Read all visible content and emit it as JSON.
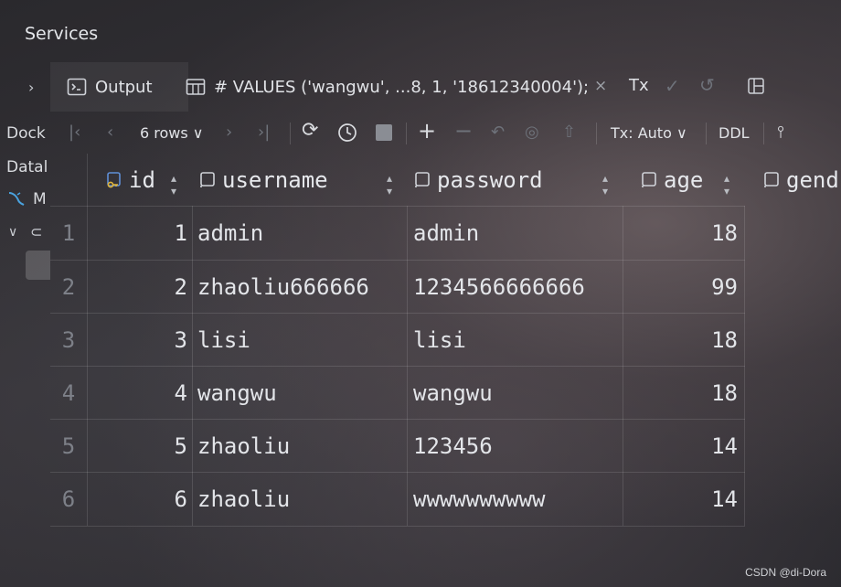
{
  "services": {
    "title": "Services"
  },
  "left_panel": {
    "item_docker": "Dock",
    "item_database": "Datal",
    "item_mysql": "M"
  },
  "tabs": {
    "output_label": "Output",
    "sql_label": "# VALUES ('wangwu', ...8, 1, '18612340004');",
    "close_glyph": "×",
    "tx_label": "Tx"
  },
  "toolbar": {
    "rows_label": "6 rows",
    "tx_mode": "Tx: Auto",
    "ddl_label": "DDL"
  },
  "table": {
    "columns": [
      "id",
      "username",
      "password",
      "age",
      "gend"
    ],
    "rows": [
      {
        "num": "1",
        "id": "1",
        "username": "admin",
        "password": "admin",
        "age": "18"
      },
      {
        "num": "2",
        "id": "2",
        "username": "zhaoliu666666",
        "password": "1234566666666",
        "age": "99"
      },
      {
        "num": "3",
        "id": "3",
        "username": "lisi",
        "password": "lisi",
        "age": "18"
      },
      {
        "num": "4",
        "id": "4",
        "username": "wangwu",
        "password": "wangwu",
        "age": "18"
      },
      {
        "num": "5",
        "id": "5",
        "username": "zhaoliu",
        "password": "123456",
        "age": "14"
      },
      {
        "num": "6",
        "id": "6",
        "username": "zhaoliu",
        "password": "wwwwwwwwww",
        "age": "14"
      }
    ]
  },
  "watermark": "CSDN @di-Dora",
  "icons": [
    "chevron-right-icon",
    "output-console-icon",
    "table-icon",
    "close-icon",
    "check-icon",
    "undo-icon",
    "layout-icon",
    "first-page-icon",
    "prev-page-icon",
    "next-page-icon",
    "last-page-icon",
    "refresh-icon",
    "history-icon",
    "stop-icon",
    "add-row-icon",
    "delete-row-icon",
    "revert-icon",
    "preview-icon",
    "submit-icon",
    "pin-icon",
    "key-column-icon",
    "column-icon",
    "mysql-icon",
    "connection-icon"
  ]
}
